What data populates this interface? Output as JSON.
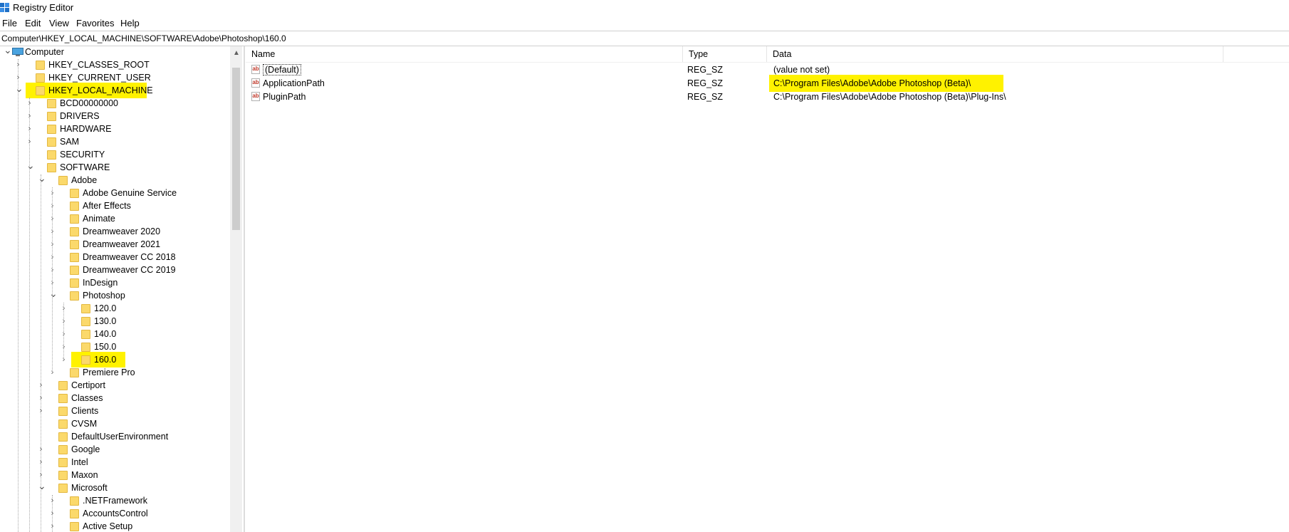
{
  "window": {
    "title": "Registry Editor"
  },
  "menu": [
    "File",
    "Edit",
    "View",
    "Favorites",
    "Help"
  ],
  "address": "Computer\\HKEY_LOCAL_MACHINE\\SOFTWARE\\Adobe\\Photoshop\\160.0",
  "tree": [
    {
      "label": "Computer",
      "level": 0,
      "expanded": true,
      "icon": "computer-icon"
    },
    {
      "label": "HKEY_CLASSES_ROOT",
      "level": 1,
      "expanded": false
    },
    {
      "label": "HKEY_CURRENT_USER",
      "level": 1,
      "expanded": false
    },
    {
      "label": "HKEY_LOCAL_MACHINE",
      "level": 1,
      "expanded": true,
      "highlight": true
    },
    {
      "label": "BCD00000000",
      "level": 2,
      "expanded": false
    },
    {
      "label": "DRIVERS",
      "level": 2,
      "expanded": false
    },
    {
      "label": "HARDWARE",
      "level": 2,
      "expanded": false
    },
    {
      "label": "SAM",
      "level": 2,
      "expanded": false
    },
    {
      "label": "SECURITY",
      "level": 2,
      "leaf": true
    },
    {
      "label": "SOFTWARE",
      "level": 2,
      "expanded": true
    },
    {
      "label": "Adobe",
      "level": 3,
      "expanded": true
    },
    {
      "label": "Adobe Genuine Service",
      "level": 4,
      "expanded": false
    },
    {
      "label": "After Effects",
      "level": 4,
      "expanded": false
    },
    {
      "label": "Animate",
      "level": 4,
      "expanded": false
    },
    {
      "label": "Dreamweaver 2020",
      "level": 4,
      "expanded": false
    },
    {
      "label": "Dreamweaver 2021",
      "level": 4,
      "expanded": false
    },
    {
      "label": "Dreamweaver CC 2018",
      "level": 4,
      "expanded": false
    },
    {
      "label": "Dreamweaver CC 2019",
      "level": 4,
      "expanded": false
    },
    {
      "label": "InDesign",
      "level": 4,
      "expanded": false
    },
    {
      "label": "Photoshop",
      "level": 4,
      "expanded": true
    },
    {
      "label": "120.0",
      "level": 5,
      "expanded": false
    },
    {
      "label": "130.0",
      "level": 5,
      "expanded": false
    },
    {
      "label": "140.0",
      "level": 5,
      "expanded": false
    },
    {
      "label": "150.0",
      "level": 5,
      "expanded": false
    },
    {
      "label": "160.0",
      "level": 5,
      "expanded": false,
      "highlight": true
    },
    {
      "label": "Premiere Pro",
      "level": 4,
      "expanded": false
    },
    {
      "label": "Certiport",
      "level": 3,
      "expanded": false
    },
    {
      "label": "Classes",
      "level": 3,
      "expanded": false
    },
    {
      "label": "Clients",
      "level": 3,
      "expanded": false
    },
    {
      "label": "CVSM",
      "level": 3,
      "leaf": true
    },
    {
      "label": "DefaultUserEnvironment",
      "level": 3,
      "leaf": true
    },
    {
      "label": "Google",
      "level": 3,
      "expanded": false
    },
    {
      "label": "Intel",
      "level": 3,
      "expanded": false
    },
    {
      "label": "Maxon",
      "level": 3,
      "expanded": false
    },
    {
      "label": "Microsoft",
      "level": 3,
      "expanded": true
    },
    {
      "label": ".NETFramework",
      "level": 4,
      "expanded": false
    },
    {
      "label": "AccountsControl",
      "level": 4,
      "expanded": false
    },
    {
      "label": "Active Setup",
      "level": 4,
      "expanded": false
    }
  ],
  "columns": {
    "name": "Name",
    "type": "Type",
    "data": "Data"
  },
  "values": [
    {
      "name": "(Default)",
      "type": "REG_SZ",
      "data": "(value not set)",
      "icon": "ab"
    },
    {
      "name": "ApplicationPath",
      "type": "REG_SZ",
      "data": "C:\\Program Files\\Adobe\\Adobe Photoshop (Beta)\\",
      "icon": "ab",
      "highlight": true
    },
    {
      "name": "PluginPath",
      "type": "REG_SZ",
      "data": "C:\\Program Files\\Adobe\\Adobe Photoshop (Beta)\\Plug-Ins\\",
      "icon": "ab"
    }
  ],
  "colors": {
    "highlight": "#fff200",
    "folder": "#fbd96b",
    "accent": "#0078d7"
  }
}
